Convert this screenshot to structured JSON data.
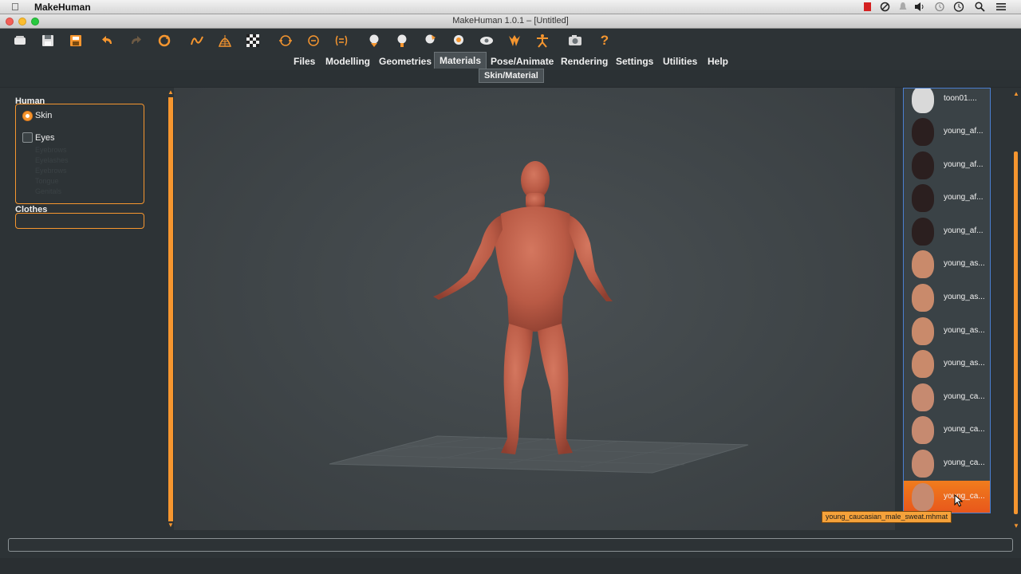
{
  "menubar": {
    "app_name": "MakeHuman",
    "tray_icons": [
      "apple-icon",
      "record-icon",
      "stop-icon",
      "notification-icon",
      "volume-icon",
      "time-machine-icon",
      "clock-icon",
      "info-icon",
      "spotlight-icon",
      "menu-list-icon"
    ]
  },
  "window": {
    "title": "MakeHuman 1.0.1 – [Untitled]"
  },
  "toolbar": {
    "icons": [
      "new-file-icon",
      "save-icon",
      "export-icon",
      "undo-icon",
      "redo-icon",
      "reset-icon",
      "smooth-icon",
      "wireframe-icon",
      "background-checker-icon",
      "front-view-icon",
      "back-view-icon",
      "left-view-icon",
      "right-view-icon",
      "top-view-icon",
      "bottom-view-icon",
      "reset-camera-icon",
      "pose-icon",
      "skeleton-icon",
      "symmetry-icon",
      "screenshot-icon",
      "help-icon"
    ]
  },
  "tabs": {
    "items": [
      "Files",
      "Modelling",
      "Geometries",
      "Materials",
      "Pose/Animate",
      "Rendering",
      "Settings",
      "Utilities",
      "Help"
    ],
    "active": "Materials",
    "subtab": "Skin/Material"
  },
  "left_panel": {
    "human_title": "Human",
    "options": [
      {
        "label": "Skin",
        "selected": true
      },
      {
        "label": "Eyes",
        "selected": false
      }
    ],
    "faded_options": [
      "Eyebrows",
      "Eyelashes",
      "Eyebrows",
      "Tongue",
      "Genitals"
    ],
    "clothes_title": "Clothes"
  },
  "material_list": {
    "items": [
      {
        "label": "toon01....",
        "skin": "#d9d9d9"
      },
      {
        "label": "young_af...",
        "skin": "#2b1f1f"
      },
      {
        "label": "young_af...",
        "skin": "#2b1f1f"
      },
      {
        "label": "young_af...",
        "skin": "#2b1f1f"
      },
      {
        "label": "young_af...",
        "skin": "#2b1f1f"
      },
      {
        "label": "young_as...",
        "skin": "#c98a6b"
      },
      {
        "label": "young_as...",
        "skin": "#c98a6b"
      },
      {
        "label": "young_as...",
        "skin": "#c98a6b"
      },
      {
        "label": "young_as...",
        "skin": "#c98a6b"
      },
      {
        "label": "young_ca...",
        "skin": "#c68a70"
      },
      {
        "label": "young_ca...",
        "skin": "#c68a70"
      },
      {
        "label": "young_ca...",
        "skin": "#c68a70"
      },
      {
        "label": "young_ca...",
        "skin": "#c68a70"
      }
    ],
    "selected_index": 12
  },
  "tooltip": {
    "text": "young_caucasian_male_sweat.mhmat"
  },
  "colors": {
    "accent": "#f6962f",
    "background": "#2d3336",
    "viewport": "#3f4548",
    "selection_blue": "#4b7fd1",
    "skin_model": "#c4614d"
  }
}
